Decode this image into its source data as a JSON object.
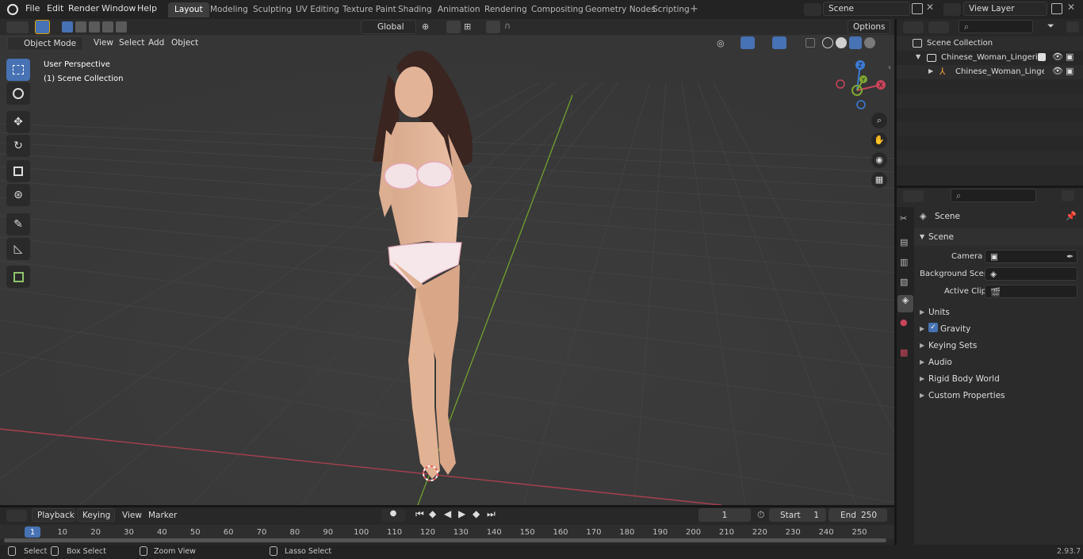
{
  "menu": {
    "items": [
      "File",
      "Edit",
      "Render",
      "Window",
      "Help"
    ]
  },
  "workspaces": [
    "Layout",
    "Modeling",
    "Sculpting",
    "UV Editing",
    "Texture Paint",
    "Shading",
    "Animation",
    "Rendering",
    "Compositing",
    "Geometry Nodes",
    "Scripting"
  ],
  "active_workspace": "Layout",
  "scene_field": "Scene",
  "view_layer_field": "View Layer",
  "toolbar": {
    "transform_orientation": "Global",
    "options_label": "Options"
  },
  "viewport_header": {
    "mode": "Object Mode",
    "menus": [
      "View",
      "Select",
      "Add",
      "Object"
    ]
  },
  "viewport_overlay": {
    "perspective": "User Perspective",
    "collection": "(1) Scene Collection"
  },
  "gizmo": {
    "x": "X",
    "y": "Y",
    "z": "Z"
  },
  "outliner": {
    "root": "Scene Collection",
    "items": [
      "Chinese_Woman_Lingerie_Fli",
      "Chinese_Woman_Lingeri"
    ]
  },
  "properties": {
    "header_title": "Scene",
    "panel_title": "Scene",
    "camera_label": "Camera",
    "background_scene_label": "Background Scene",
    "active_clip_label": "Active Clip",
    "sections": [
      "Units",
      "Gravity",
      "Keying Sets",
      "Audio",
      "Rigid Body World",
      "Custom Properties"
    ],
    "gravity_checked": true
  },
  "timeline": {
    "menus": [
      "Playback",
      "Keying",
      "View",
      "Marker"
    ],
    "current_frame": "1",
    "start_label": "Start",
    "start_value": "1",
    "end_label": "End",
    "end_value": "250",
    "ticks": [
      "1",
      "10",
      "20",
      "30",
      "40",
      "50",
      "60",
      "70",
      "80",
      "90",
      "100",
      "110",
      "120",
      "130",
      "140",
      "150",
      "160",
      "170",
      "180",
      "190",
      "200",
      "210",
      "220",
      "230",
      "240",
      "250"
    ]
  },
  "statusbar": {
    "select": "Select",
    "box_select": "Box Select",
    "zoom_view": "Zoom View",
    "lasso_select": "Lasso Select",
    "version": "2.93.7"
  },
  "colors": {
    "accent": "#4772b3",
    "x_axis": "#c8455a",
    "y_axis": "#7fa832",
    "z_axis": "#3c7cd6"
  }
}
